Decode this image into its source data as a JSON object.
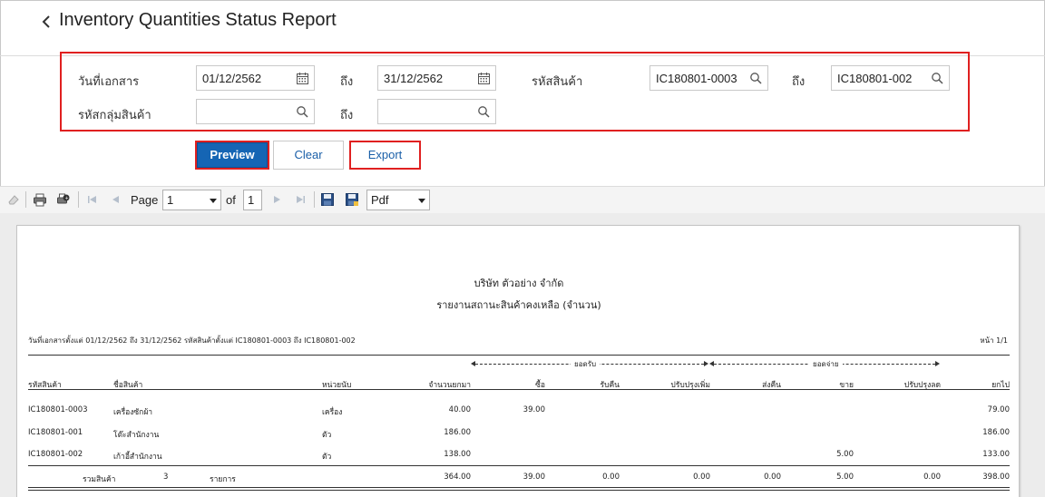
{
  "header": {
    "title": "Inventory Quantities Status Report"
  },
  "filters": {
    "doc_date_label": "วันที่เอกสาร",
    "doc_date_from": "01/12/2562",
    "to_label": "ถึง",
    "doc_date_to": "31/12/2562",
    "product_code_label": "รหัสสินค้า",
    "product_code_from": "IC180801-0003",
    "product_code_to": "IC180801-002",
    "product_group_label": "รหัสกลุ่มสินค้า",
    "product_group_from": "",
    "product_group_to": ""
  },
  "buttons": {
    "preview": "Preview",
    "clear": "Clear",
    "export": "Export"
  },
  "viewer_toolbar": {
    "page_label": "Page",
    "page_value": "1",
    "of_label": "of",
    "total_pages": "1",
    "format_value": "Pdf"
  },
  "report": {
    "company": "บริษัท ตัวอย่าง จำกัด",
    "title": "รายงานสถานะสินค้าคงเหลือ (จำนวน)",
    "condition": "วันที่เอกสารตั้งแต่ 01/12/2562 ถึง 31/12/2562 รหัสสินค้าตั้งแต่ IC180801-0003 ถึง IC180801-002",
    "page_info": "หน้า 1/1",
    "group_receive": "ยอดรับ",
    "group_issue": "ยอดจ่าย",
    "columns": {
      "code": "รหัสสินค้า",
      "name": "ชื่อสินค้า",
      "unit": "หน่วยนับ",
      "brought_forward": "จำนวนยกมา",
      "buy": "ซื้อ",
      "return_in": "รับคืน",
      "adjust_up": "ปรับปรุงเพิ่ม",
      "return_out": "ส่งคืน",
      "sell": "ขาย",
      "adjust_down": "ปรับปรุงลด",
      "carried_forward": "ยกไป"
    },
    "rows": [
      {
        "code": "IC180801-0003",
        "name": "เครื่องซักผ้า",
        "unit": "เครื่อง",
        "brought_forward": "40.00",
        "buy": "39.00",
        "return_in": "",
        "adjust_up": "",
        "return_out": "",
        "sell": "",
        "adjust_down": "",
        "carried_forward": "79.00"
      },
      {
        "code": "IC180801-001",
        "name": "โต๊ะสำนักงาน",
        "unit": "ตัว",
        "brought_forward": "186.00",
        "buy": "",
        "return_in": "",
        "adjust_up": "",
        "return_out": "",
        "sell": "",
        "adjust_down": "",
        "carried_forward": "186.00"
      },
      {
        "code": "IC180801-002",
        "name": "เก้าอี้สำนักงาน",
        "unit": "ตัว",
        "brought_forward": "138.00",
        "buy": "",
        "return_in": "",
        "adjust_up": "",
        "return_out": "",
        "sell": "5.00",
        "adjust_down": "",
        "carried_forward": "133.00"
      }
    ],
    "total": {
      "label": "รวมสินค้า",
      "count": "3",
      "count_unit": "รายการ",
      "brought_forward": "364.00",
      "buy": "39.00",
      "return_in": "0.00",
      "adjust_up": "0.00",
      "return_out": "0.00",
      "sell": "5.00",
      "adjust_down": "0.00",
      "carried_forward": "398.00"
    }
  }
}
